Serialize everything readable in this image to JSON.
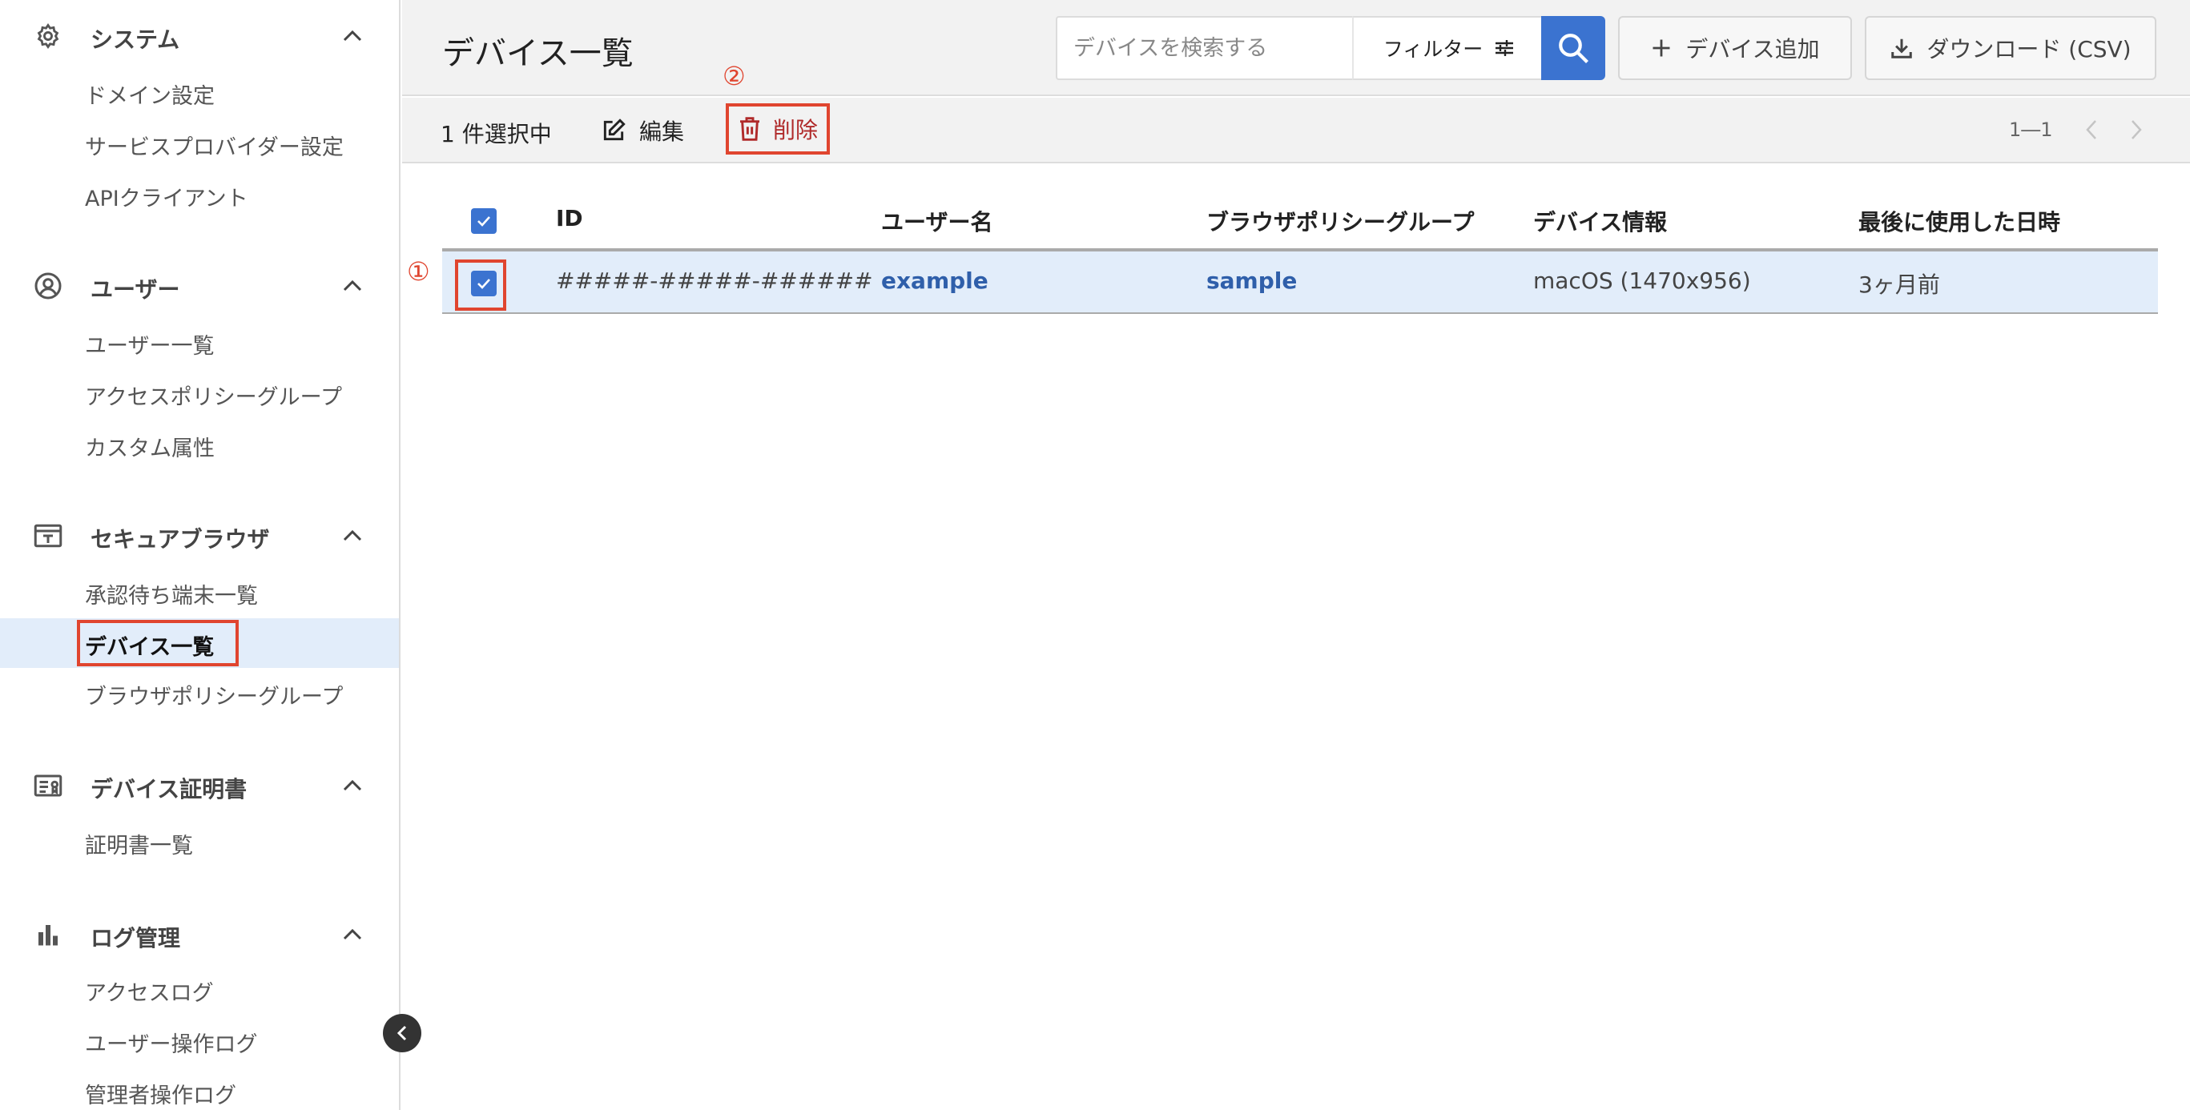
{
  "sidebar": {
    "sections": [
      {
        "title": "システム",
        "icon": "gear-icon",
        "items": [
          "ドメイン設定",
          "サービスプロバイダー設定",
          "APIクライアント"
        ]
      },
      {
        "title": "ユーザー",
        "icon": "user-icon",
        "items": [
          "ユーザー一覧",
          "アクセスポリシーグループ",
          "カスタム属性"
        ]
      },
      {
        "title": "セキュアブラウザ",
        "icon": "browser-icon",
        "items": [
          "承認待ち端末一覧",
          "デバイス一覧",
          "ブラウザポリシーグループ"
        ]
      },
      {
        "title": "デバイス証明書",
        "icon": "certificate-icon",
        "items": [
          "証明書一覧"
        ]
      },
      {
        "title": "ログ管理",
        "icon": "bar-chart-icon",
        "items": [
          "アクセスログ",
          "ユーザー操作ログ",
          "管理者操作ログ"
        ]
      }
    ],
    "active_item": "デバイス一覧"
  },
  "header": {
    "title": "デバイス一覧",
    "search_placeholder": "デバイスを検索する",
    "filter_label": "フィルター",
    "add_label": "デバイス追加",
    "download_label": "ダウンロード (CSV)"
  },
  "action_bar": {
    "selected_text": "1 件選択中",
    "edit_label": "編集",
    "delete_label": "削除",
    "pager_text": "1―1"
  },
  "annotations": {
    "step1": "①",
    "step2": "②"
  },
  "table": {
    "columns": [
      "ID",
      "ユーザー名",
      "ブラウザポリシーグループ",
      "デバイス情報",
      "最後に使用した日時"
    ],
    "rows": [
      {
        "id": "#####-#####-######",
        "user": "example",
        "policy_group": "sample",
        "device_info": "macOS (1470x956)",
        "last_used": "3ヶ月前",
        "selected": true
      }
    ],
    "all_selected": true
  },
  "colors": {
    "accent": "#3b73d0",
    "highlight": "#e0452f",
    "row_selected": "#e2edfa",
    "link": "#2f5faa"
  }
}
